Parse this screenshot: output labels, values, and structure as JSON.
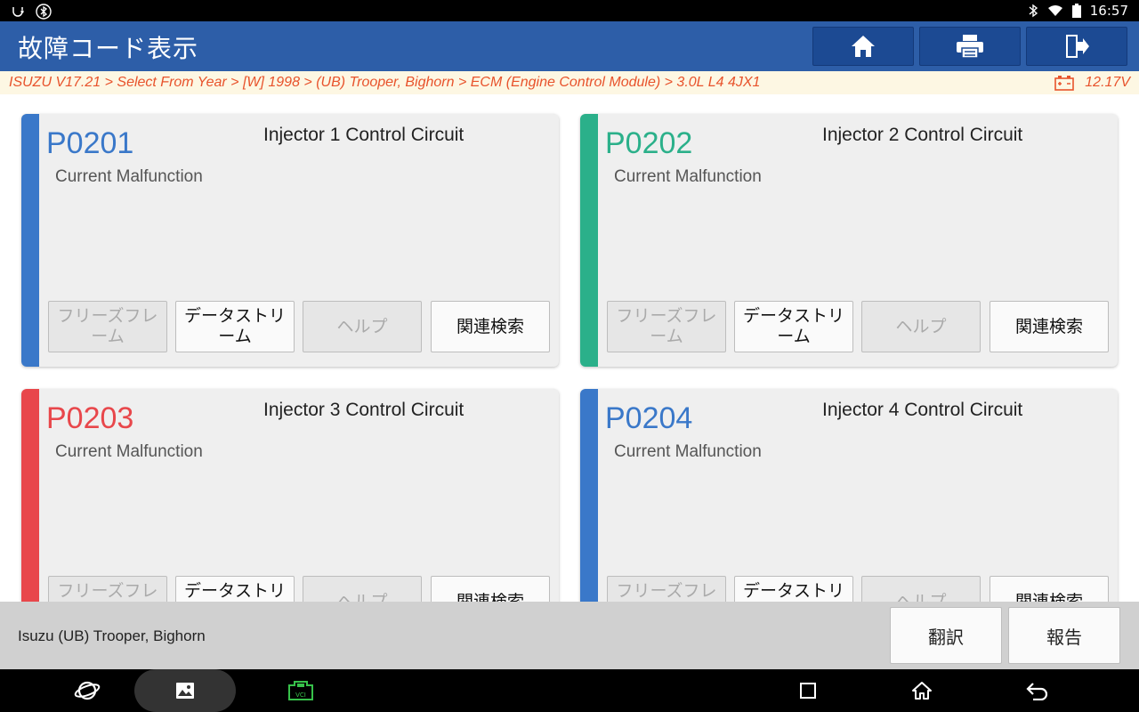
{
  "app": {
    "title": "故障コード表示"
  },
  "status_bar": {
    "time": "16:57"
  },
  "breadcrumb": {
    "path": "ISUZU V17.21 > Select From Year > [W] 1998 > (UB) Trooper, Bighorn > ECM (Engine Control Module) > 3.0L L4 4JX1",
    "voltage": "12.17V"
  },
  "toolbar": {
    "home_icon": "home-icon",
    "print_icon": "printer-icon",
    "exit_icon": "exit-icon"
  },
  "dtcs": [
    {
      "code": "P0201",
      "description": "Injector 1 Control Circuit",
      "status": "Current Malfunction",
      "color": "#3a78c9",
      "buttons": [
        {
          "label": "フリーズフレーム",
          "enabled": false
        },
        {
          "label": "データストリーム",
          "enabled": true
        },
        {
          "label": "ヘルプ",
          "enabled": false
        },
        {
          "label": "関連検索",
          "enabled": true
        }
      ]
    },
    {
      "code": "P0202",
      "description": "Injector 2 Control Circuit",
      "status": "Current Malfunction",
      "color": "#2bb08a",
      "buttons": [
        {
          "label": "フリーズフレーム",
          "enabled": false
        },
        {
          "label": "データストリーム",
          "enabled": true
        },
        {
          "label": "ヘルプ",
          "enabled": false
        },
        {
          "label": "関連検索",
          "enabled": true
        }
      ]
    },
    {
      "code": "P0203",
      "description": "Injector 3 Control Circuit",
      "status": "Current Malfunction",
      "color": "#e8474b",
      "buttons": [
        {
          "label": "フリーズフレーム",
          "enabled": false
        },
        {
          "label": "データストリーム",
          "enabled": true
        },
        {
          "label": "ヘルプ",
          "enabled": false
        },
        {
          "label": "関連検索",
          "enabled": true
        }
      ]
    },
    {
      "code": "P0204",
      "description": "Injector 4 Control Circuit",
      "status": "Current Malfunction",
      "color": "#3a78c9",
      "buttons": [
        {
          "label": "フリーズフレーム",
          "enabled": false
        },
        {
          "label": "データストリーム",
          "enabled": true
        },
        {
          "label": "ヘルプ",
          "enabled": false
        },
        {
          "label": "関連検索",
          "enabled": true
        }
      ]
    }
  ],
  "footer": {
    "vehicle": "Isuzu (UB) Trooper, Bighorn",
    "translate_label": "翻訳",
    "report_label": "報告"
  },
  "nav_bar": {
    "vci_label": "VCI"
  }
}
